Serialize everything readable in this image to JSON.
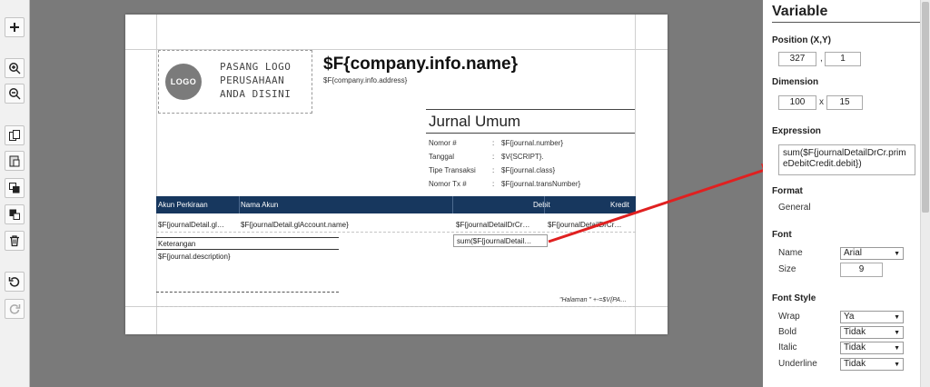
{
  "toolbar": {
    "buttons": [
      {
        "icon": "plus-icon",
        "glyph": "+"
      },
      {
        "icon": "zoom-in-icon",
        "glyph": "⊕"
      },
      {
        "icon": "zoom-out-icon",
        "glyph": "⊖"
      },
      {
        "icon": "copy-icon",
        "glyph": "❐"
      },
      {
        "icon": "paste-icon",
        "glyph": "📋"
      },
      {
        "icon": "bring-front-icon",
        "glyph": "■"
      },
      {
        "icon": "send-back-icon",
        "glyph": "■"
      },
      {
        "icon": "delete-icon",
        "glyph": "🗑"
      },
      {
        "icon": "undo-icon",
        "glyph": "↺"
      },
      {
        "icon": "redo-icon",
        "glyph": "↻"
      }
    ]
  },
  "report": {
    "logo_label": "LOGO",
    "logo_text": "PASANG LOGO\nPERUSAHAAN\nANDA DISINI",
    "company_name": "$F{company.info.name}",
    "company_address": "$F{company.info.address}",
    "title": "Jurnal Umum",
    "info": [
      {
        "key": "Nomor #",
        "sep": ":",
        "value": "$F{journal.number}"
      },
      {
        "key": "Tanggal",
        "sep": ":",
        "value": "$V{SCRIPT}."
      },
      {
        "key": "Tipe Transaksi",
        "sep": ":",
        "value": "$F{journal.class}"
      },
      {
        "key": "Nomor Tx #",
        "sep": ":",
        "value": "$F{journal.transNumber}"
      }
    ],
    "columns": {
      "akun": "Akun Perkiraan",
      "nama": "Nama Akun",
      "debit": "Debit",
      "kredit": "Kredit"
    },
    "row": {
      "akun": "$F{journalDetail.gl…",
      "nama": "$F{journalDetail.glAccount.name}",
      "debit": "$F{journalDetailDrCr…",
      "kredit": "$F{journalDetailDrCr…"
    },
    "sum_debit": "sum($F{journalDetail…",
    "keterangan_label": "Keterangan",
    "keterangan_value": "$F{journal.description}",
    "footer": "\"Halaman \" +-=$V{PA…"
  },
  "panel": {
    "title": "Variable",
    "position_label": "Position (X,Y)",
    "pos_x": "327",
    "pos_sep": ",",
    "pos_y": "1",
    "dimension_label": "Dimension",
    "dim_w": "100",
    "dim_sep": "x",
    "dim_h": "15",
    "expression_label": "Expression",
    "expression": "sum($F{journalDetailDrCr.primeDebitCredit.debit})",
    "format_label": "Format",
    "format_value": "General",
    "font_label": "Font",
    "font_name_label": "Name",
    "font_name": "Arial",
    "font_size_label": "Size",
    "font_size": "9",
    "font_style_label": "Font Style",
    "wrap_label": "Wrap",
    "wrap_value": "Ya",
    "bold_label": "Bold",
    "bold_value": "Tidak",
    "italic_label": "Italic",
    "italic_value": "Tidak",
    "underline_label": "Underline",
    "underline_value": "Tidak"
  },
  "colors": {
    "header_bg": "#17375e",
    "arrow": "#e02020"
  }
}
